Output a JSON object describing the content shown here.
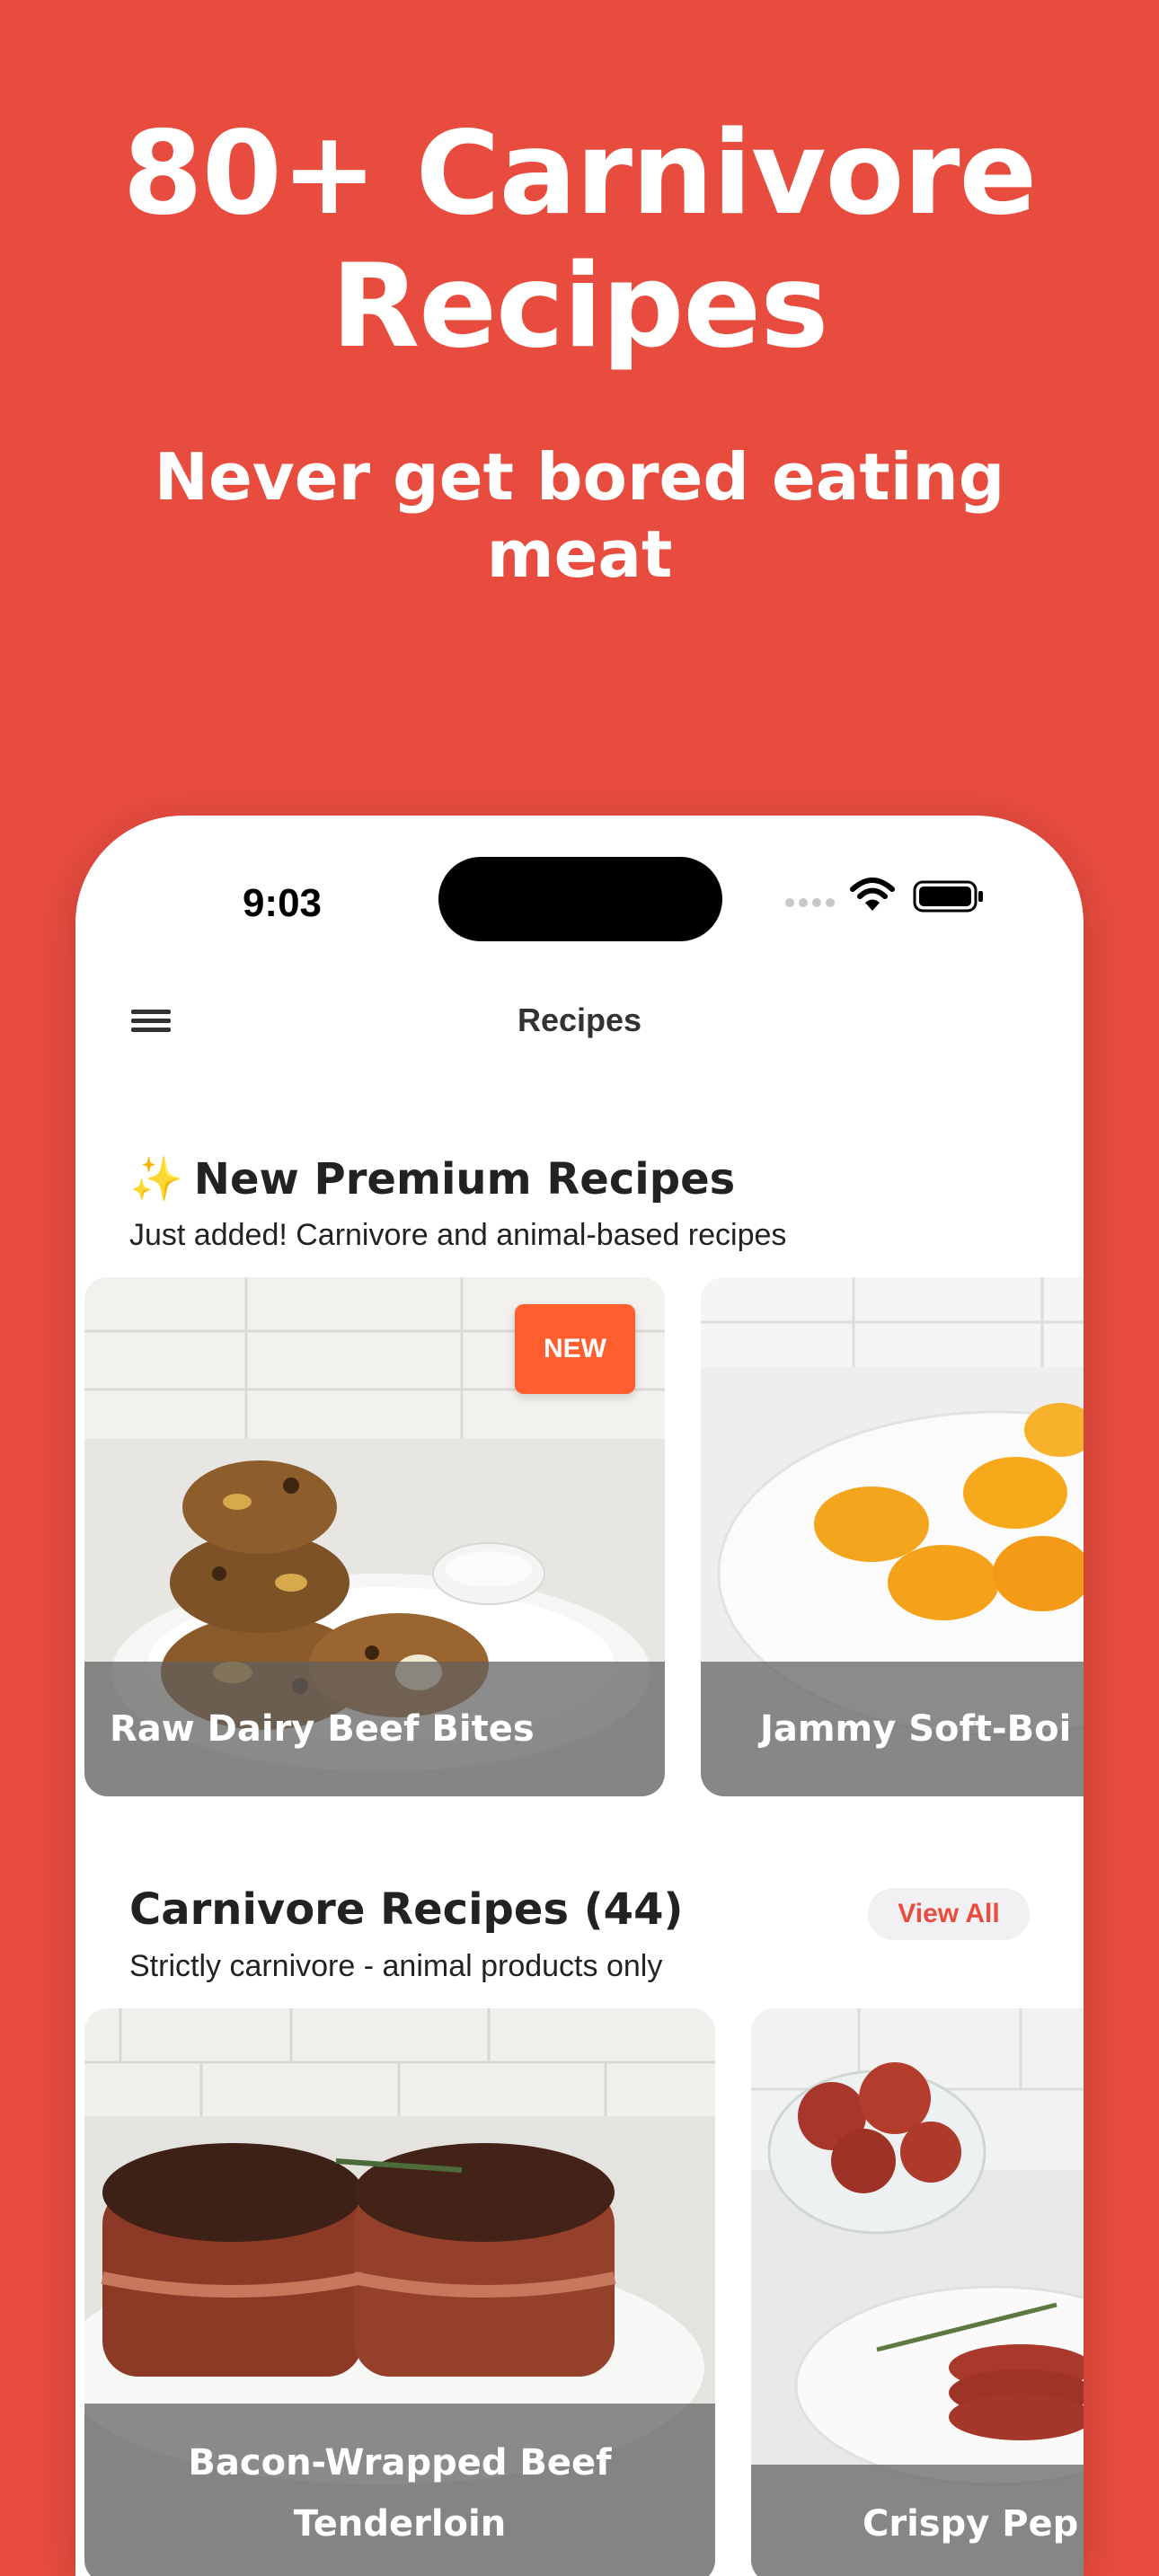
{
  "promo": {
    "headline": "80+ Carnivore Recipes",
    "subheadline": "Never get bored eating meat"
  },
  "status_bar": {
    "time": "9:03"
  },
  "nav": {
    "title": "Recipes",
    "menu_icon": "hamburger-menu-icon"
  },
  "premium_section": {
    "title": "New Premium Recipes",
    "title_icon": "sparkles-icon",
    "subtitle": "Just added! Carnivore and animal-based recipes",
    "cards": [
      {
        "title": "Raw Dairy Beef Bites",
        "badge": "NEW"
      },
      {
        "title": "Jammy Soft-Boi"
      }
    ]
  },
  "carnivore_section": {
    "title": "Carnivore Recipes (44)",
    "subtitle": "Strictly carnivore - animal products only",
    "view_all_label": "View All",
    "cards": [
      {
        "title": "Bacon-Wrapped Beef Tenderloin"
      },
      {
        "title": "Crispy Pep"
      }
    ]
  },
  "colors": {
    "background": "#E84C3F",
    "accent": "#E84C3F",
    "badge": "#FF5F2E",
    "caption_overlay": "#5F5F5F"
  }
}
